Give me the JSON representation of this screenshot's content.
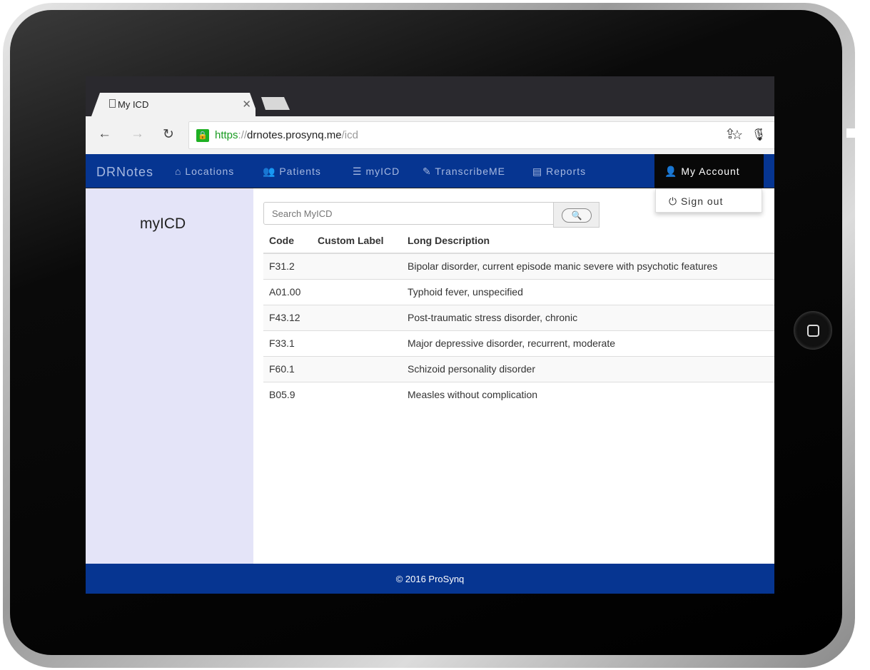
{
  "browser": {
    "tab_title": "My ICD",
    "url_scheme": "https",
    "url_sep": "://",
    "url_host": "drnotes.prosynq.me",
    "url_path": "/icd"
  },
  "nav": {
    "brand": "DRNotes",
    "items": [
      {
        "label": "Locations",
        "icon": "home-icon"
      },
      {
        "label": "Patients",
        "icon": "users-icon"
      },
      {
        "label": "myICD",
        "icon": "list-icon"
      },
      {
        "label": "TranscribeME",
        "icon": "pencil-icon"
      },
      {
        "label": "Reports",
        "icon": "document-icon"
      }
    ],
    "account": "My Account",
    "sign_out": "Sign out"
  },
  "sidebar": {
    "title": "myICD"
  },
  "search": {
    "placeholder": "Search MyICD"
  },
  "table": {
    "headers": [
      "Code",
      "Custom Label",
      "Long Description"
    ],
    "rows": [
      [
        "F31.2",
        "",
        "Bipolar disorder, current episode manic severe with psychotic features"
      ],
      [
        "A01.00",
        "",
        "Typhoid fever, unspecified"
      ],
      [
        "F43.12",
        "",
        "Post-traumatic stress disorder, chronic"
      ],
      [
        "F33.1",
        "",
        "Major depressive disorder, recurrent, moderate"
      ],
      [
        "F60.1",
        "",
        "Schizoid personality disorder"
      ],
      [
        "B05.9",
        "",
        "Measles without complication"
      ]
    ]
  },
  "footer": {
    "text": "© 2016 ProSynq"
  },
  "colors": {
    "nav": "#063591",
    "sidebar": "#e4e4f8",
    "account": "#080808"
  }
}
